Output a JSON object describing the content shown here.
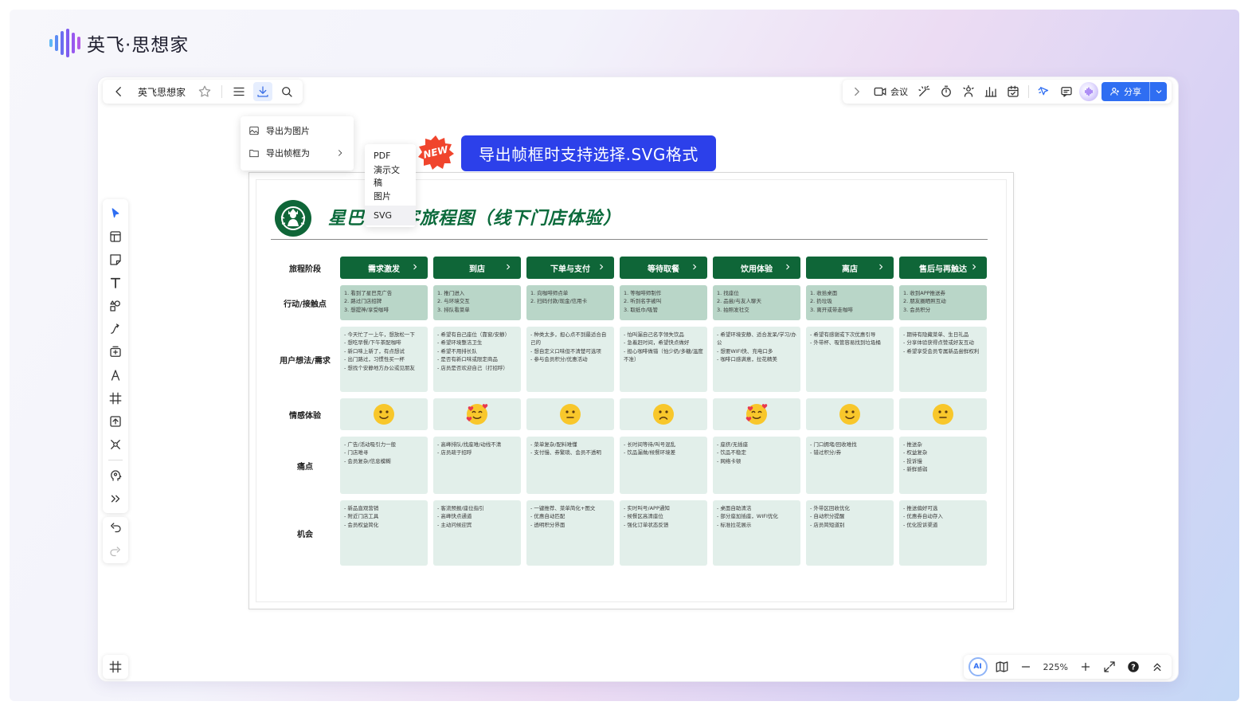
{
  "app": {
    "brand_name": "英飞·思想家"
  },
  "toolbar_left": {
    "back_icon": "arrow-left-icon",
    "doc_title": "英飞思想家",
    "star_icon": "star-icon",
    "menu_icon": "hamburger-icon",
    "export_icon": "download-icon",
    "search_icon": "search-icon"
  },
  "toolbar_right": {
    "expand_icon": "chevron-right-icon",
    "meeting_label": "会议",
    "share_label": "分享",
    "icons": [
      "video-icon",
      "magic-wand-icon",
      "timer-icon",
      "celebrate-icon",
      "chart-icon",
      "calendar-icon",
      "cursor-follow-icon",
      "comment-icon",
      "voice-icon",
      "user-icon",
      "chevron-down-icon"
    ]
  },
  "export_menu": {
    "items": [
      {
        "label": "导出为图片",
        "icon": "image-icon"
      },
      {
        "label": "导出帧框为",
        "icon": "folder-icon"
      }
    ]
  },
  "export_submenu": {
    "items": [
      "PDF",
      "演示文稿",
      "图片",
      "SVG"
    ],
    "hovered": "SVG"
  },
  "promo": {
    "badge": "NEW",
    "banner": "导出帧框时支持选择.SVG格式",
    "badge_color": "#f0452d",
    "banner_color": "#2c40ea"
  },
  "left_toolbar": {
    "tools": [
      "select-arrow-icon",
      "template-icon",
      "sticky-note-icon",
      "text-icon",
      "shapes-icon",
      "connector-icon",
      "add-card-icon",
      "pen-icon",
      "frame-tool-icon",
      "upload-icon",
      "mindmap-icon",
      "ai-brain-icon",
      "more-icon"
    ],
    "history": [
      "undo-icon",
      "redo-icon"
    ]
  },
  "bottom_bar": {
    "zoom": "225%"
  },
  "journey_map": {
    "title": "星巴克顾客旅程图（线下门店体验）",
    "accent": "#0f6638",
    "rows": {
      "stage": "旅程阶段",
      "touch": "行动/接触点",
      "think": "用户想法/需求",
      "emotion": "情感体验",
      "pain": "痛点",
      "opportunity": "机会"
    },
    "stages": [
      {
        "name": "需求激发",
        "touch": [
          "1. 看到了星巴克广告",
          "2. 路过门店招牌",
          "3. 想提神/享受咖啡"
        ],
        "think": [
          "- 今天忙了一上午，想放松一下",
          "- 想吃早餐/下午茶配咖啡",
          "- 新口味上新了，有点想试",
          "- 出门路过，习惯性买一杯",
          "- 想找个安静地方办公或见朋友"
        ],
        "emotion": "slightly-smiling-face",
        "pain": [
          "- 广告/活动吸引力一般",
          "- 门店难寻",
          "- 会员复杂/信息模糊"
        ],
        "opportunity": [
          "- 新品直观营销",
          "- 附近门店工具",
          "- 会员权益简化"
        ]
      },
      {
        "name": "到店",
        "touch": [
          "1. 推门进入",
          "2. 与环境交互",
          "3. 排队看菜单"
        ],
        "think": [
          "- 希望有自己座位（靠窗/安静）",
          "- 希望环境整洁卫生",
          "- 希望不用排长队",
          "- 是否有新口味或限定商品",
          "- 店员是否欢迎自己（打招呼）"
        ],
        "emotion": "smiling-face-with-hearts",
        "pain": [
          "- 高峰排队/找座难/动线不清",
          "- 店员疏于招呼"
        ],
        "opportunity": [
          "- 客流预报/座位指引",
          "- 高峰快点通道",
          "- 主动问候迎宾"
        ]
      },
      {
        "name": "下单与支付",
        "touch": [
          "1. 向咖啡师点单",
          "2. 扫码付款/现金/信用卡"
        ],
        "think": [
          "- 种类太多，担心点不到最适合自己的",
          "- 想自定义口味但不清楚可选项",
          "- 参与会员积分/优惠活动"
        ],
        "emotion": "neutral-face",
        "pain": [
          "- 菜单复杂/配料难懂",
          "- 支付慢、券繁琐、会员不透明"
        ],
        "opportunity": [
          "- 一键推荐、菜单简化+图文",
          "- 优惠自动匹配",
          "- 透明积分界面"
        ]
      },
      {
        "name": "等待取餐",
        "touch": [
          "1. 等咖啡师制作",
          "2. 听到名字被叫",
          "3. 取纸巾/吸管"
        ],
        "think": [
          "- 怕叫漏自己名字领失饮品",
          "- 急着赶时间，希望快点做好",
          "- 担心咖啡做错（怕少奶/多糖/温度不准）"
        ],
        "emotion": "slightly-frowning-face",
        "pain": [
          "- 长时间等待/叫号混乱",
          "- 饮品漏做/候餐环境差"
        ],
        "opportunity": [
          "- 实时叫号/APP通知",
          "- 候餐区高清座位",
          "- 强化订单状态反馈"
        ]
      },
      {
        "name": "饮用体验",
        "touch": [
          "1. 找座位",
          "2. 品尝/与友人聊天",
          "3. 拍照发社交"
        ],
        "think": [
          "- 希望环境安静、适合发呆/学习/办公",
          "- 想要WIFI快、充电口多",
          "- 咖啡口感满意，拉花精美"
        ],
        "emotion": "smiling-face-with-hearts",
        "pain": [
          "- 座挤/无插座",
          "- 饮品不稳定",
          "- 网络卡顿"
        ],
        "opportunity": [
          "- 桌面自助清洁",
          "- 部分座加插座，WIFI优化",
          "- 标准拉花展示"
        ]
      },
      {
        "name": "离店",
        "touch": [
          "1. 收拾桌面",
          "2. 扔垃圾",
          "3. 离开或带走咖啡"
        ],
        "think": [
          "- 希望有感谢或下次优惠引导",
          "- 外带杯、吸管容易找到垃圾桶"
        ],
        "emotion": "slightly-smiling-face",
        "pain": [
          "- 门口拥堵/回收难找",
          "- 错过积分/券"
        ],
        "opportunity": [
          "- 外带区回收优化",
          "- 自动积分提醒",
          "- 店员简短道别"
        ]
      },
      {
        "name": "售后与再触达",
        "touch": [
          "1. 收到APP推送券",
          "2. 朋友圈晒照互动",
          "3. 会员积分"
        ],
        "think": [
          "- 期待有隐藏菜单、生日礼品",
          "- 分享体验获得点赞或好友互动",
          "- 希望享受会员专属新品尝鲜权利"
        ],
        "emotion": "neutral-face",
        "pain": [
          "- 推送杂",
          "- 权益复杂",
          "- 投诉慢",
          "- 新鲜感弱"
        ],
        "opportunity": [
          "- 推送偏好可选",
          "- 优惠券自动存入",
          "- 优化投诉渠道"
        ]
      }
    ]
  }
}
